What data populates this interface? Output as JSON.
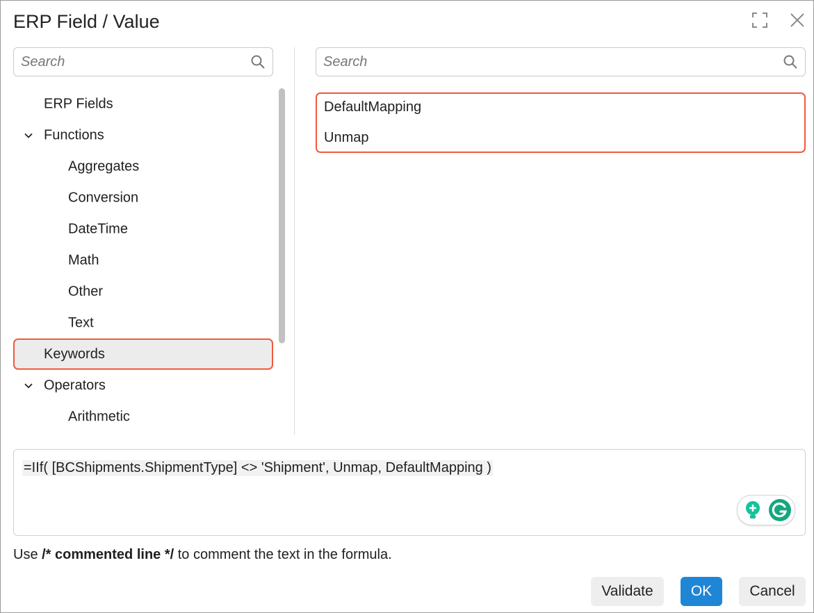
{
  "dialog": {
    "title": "ERP Field / Value"
  },
  "left_panel": {
    "search_placeholder": "Search",
    "tree": [
      {
        "label": "ERP Fields",
        "level": 0,
        "expander": "none",
        "selected": false
      },
      {
        "label": "Functions",
        "level": 0,
        "expander": "chevron-down",
        "selected": false
      },
      {
        "label": "Aggregates",
        "level": 1,
        "expander": "none",
        "selected": false
      },
      {
        "label": "Conversion",
        "level": 1,
        "expander": "none",
        "selected": false
      },
      {
        "label": "DateTime",
        "level": 1,
        "expander": "none",
        "selected": false
      },
      {
        "label": "Math",
        "level": 1,
        "expander": "none",
        "selected": false
      },
      {
        "label": "Other",
        "level": 1,
        "expander": "none",
        "selected": false
      },
      {
        "label": "Text",
        "level": 1,
        "expander": "none",
        "selected": false
      },
      {
        "label": "Keywords",
        "level": 0,
        "expander": "none",
        "selected": true
      },
      {
        "label": "Operators",
        "level": 0,
        "expander": "chevron-down",
        "selected": false
      },
      {
        "label": "Arithmetic",
        "level": 1,
        "expander": "none",
        "selected": false
      }
    ]
  },
  "right_panel": {
    "search_placeholder": "Search",
    "items": [
      "DefaultMapping",
      "Unmap"
    ]
  },
  "formula": {
    "text": "=IIf( [BCShipments.ShipmentType] <> 'Shipment', Unmap, DefaultMapping )"
  },
  "hint": {
    "prefix": "Use ",
    "bold": "/* commented line */",
    "suffix": " to comment the text in the formula."
  },
  "buttons": {
    "validate": "Validate",
    "ok": "OK",
    "cancel": "Cancel"
  },
  "icons": {
    "expand": "expand-icon",
    "close": "close-icon",
    "search": "search-icon",
    "chevron": "chevron-down-icon",
    "grammarly_bulb": "grammarly-bulb-icon",
    "grammarly_logo": "grammarly-logo-icon"
  },
  "colors": {
    "selection_border": "#ef5a3c",
    "primary_button": "#1f86d6",
    "grammarly_green": "#15c39a"
  }
}
